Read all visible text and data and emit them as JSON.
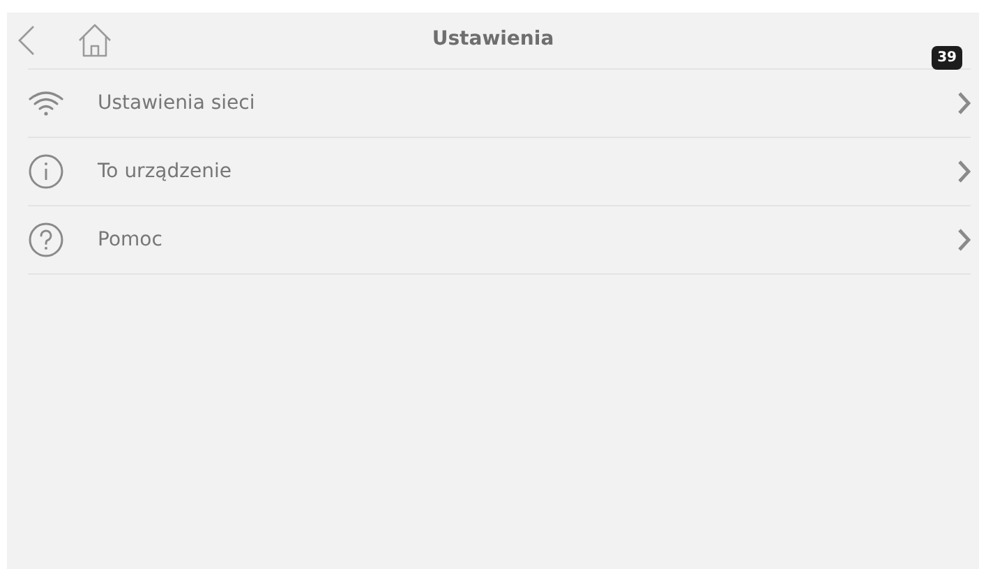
{
  "header": {
    "title": "Ustawienia",
    "badge": "39"
  },
  "items": [
    {
      "kind": "wifi",
      "label": "Ustawienia sieci"
    },
    {
      "kind": "info",
      "label": "To urządzenie"
    },
    {
      "kind": "help",
      "label": "Pomoc"
    }
  ]
}
